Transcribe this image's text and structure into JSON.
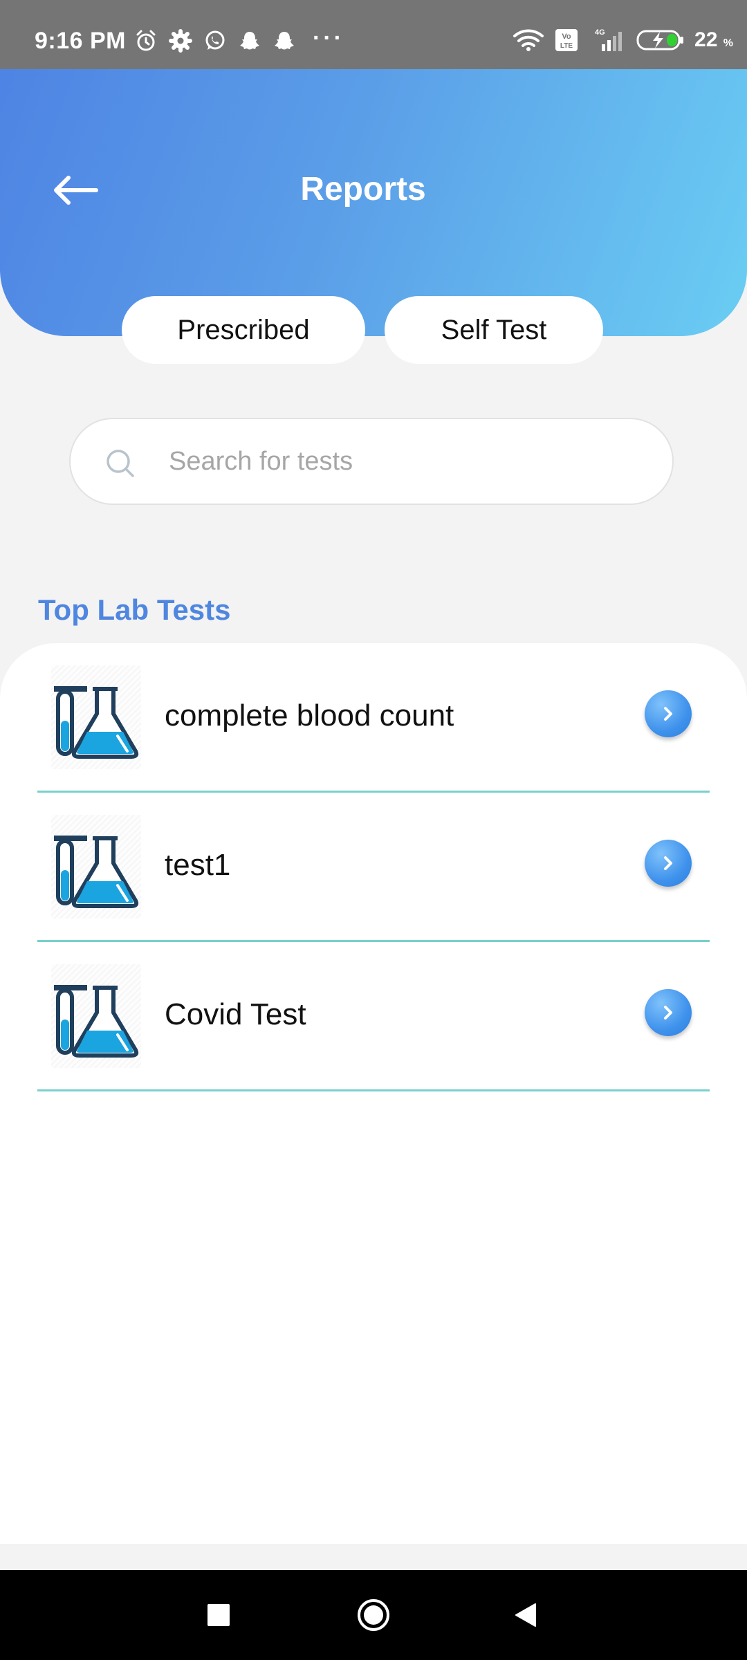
{
  "status_bar": {
    "time": "9:16 PM",
    "more": "···",
    "battery_percent": "22",
    "percent_sign": "%",
    "network": "4G"
  },
  "header": {
    "title": "Reports",
    "back_icon": "arrow-left-icon"
  },
  "tabs": [
    {
      "label": "Prescribed"
    },
    {
      "label": "Self Test"
    }
  ],
  "search": {
    "placeholder": "Search for tests",
    "value": ""
  },
  "section": {
    "title": "Top Lab Tests"
  },
  "tests": [
    {
      "name": "complete blood count"
    },
    {
      "name": "test1"
    },
    {
      "name": "Covid Test"
    }
  ],
  "colors": {
    "header_start": "#4e84e4",
    "header_end": "#6acdf3",
    "accent": "#4f86e0",
    "divider": "#79d0cc"
  }
}
